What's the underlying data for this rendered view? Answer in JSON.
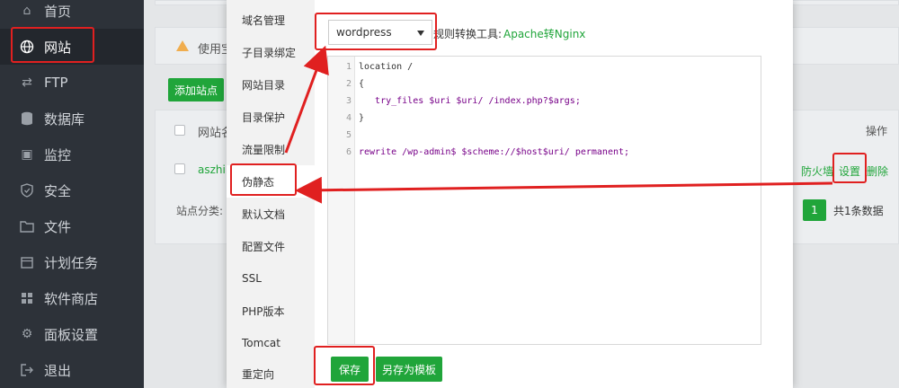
{
  "sidebar": {
    "items": [
      {
        "label": "首页",
        "icon": "home-icon"
      },
      {
        "label": "网站",
        "icon": "globe-icon"
      },
      {
        "label": "FTP",
        "icon": "ftp-icon"
      },
      {
        "label": "数据库",
        "icon": "database-icon"
      },
      {
        "label": "监控",
        "icon": "monitor-icon"
      },
      {
        "label": "安全",
        "icon": "shield-icon"
      },
      {
        "label": "文件",
        "icon": "folder-icon"
      },
      {
        "label": "计划任务",
        "icon": "calendar-icon"
      },
      {
        "label": "软件商店",
        "icon": "store-icon"
      },
      {
        "label": "面板设置",
        "icon": "gear-icon"
      },
      {
        "label": "退出",
        "icon": "logout-icon"
      }
    ],
    "active_index": 1
  },
  "background": {
    "warning_text": "使用宝",
    "add_site_label": "添加站点",
    "col_site_name": "网站名",
    "col_actions": "操作",
    "site_name": "aszhi.c",
    "action_firewall": "防火墙",
    "action_settings": "设置",
    "action_delete": "删除",
    "category_label": "站点分类:",
    "page_number": "1",
    "total_text": "共1条数据"
  },
  "modal": {
    "menu": [
      "域名管理",
      "子目录绑定",
      "网站目录",
      "目录保护",
      "流量限制",
      "伪静态",
      "默认文档",
      "配置文件",
      "SSL",
      "PHP版本",
      "Tomcat",
      "重定向"
    ],
    "active_menu_index": 5,
    "template_select": "wordpress",
    "rule_tool_label": "规则转换工具:",
    "rule_tool_link": "Apache转Nginx",
    "code_lines": [
      "location /",
      "{",
      "   try_files $uri $uri/ /index.php?$args;",
      "}",
      "",
      "rewrite /wp-admin$ $scheme://$host$uri/ permanent;"
    ],
    "save_label": "保存",
    "save_template_label": "另存为模板"
  },
  "colors": {
    "accent_green": "#20a53a",
    "sidebar_bg": "#2d3239",
    "annotation_red": "#e02020"
  }
}
